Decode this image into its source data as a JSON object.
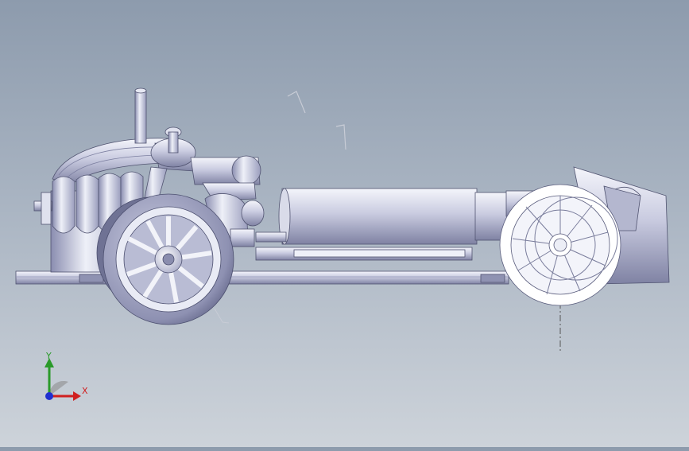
{
  "viewport": {
    "model": "car-chassis-assembly",
    "view_orientation": "front"
  },
  "triad": {
    "x_label": "X",
    "y_label": "Y",
    "x_color": "#d02020",
    "y_color": "#2a9a2a",
    "z_color": "#2030d0"
  },
  "icons": [
    "axis-triad-icon",
    "reference-axis-icon",
    "centerline-icon"
  ]
}
